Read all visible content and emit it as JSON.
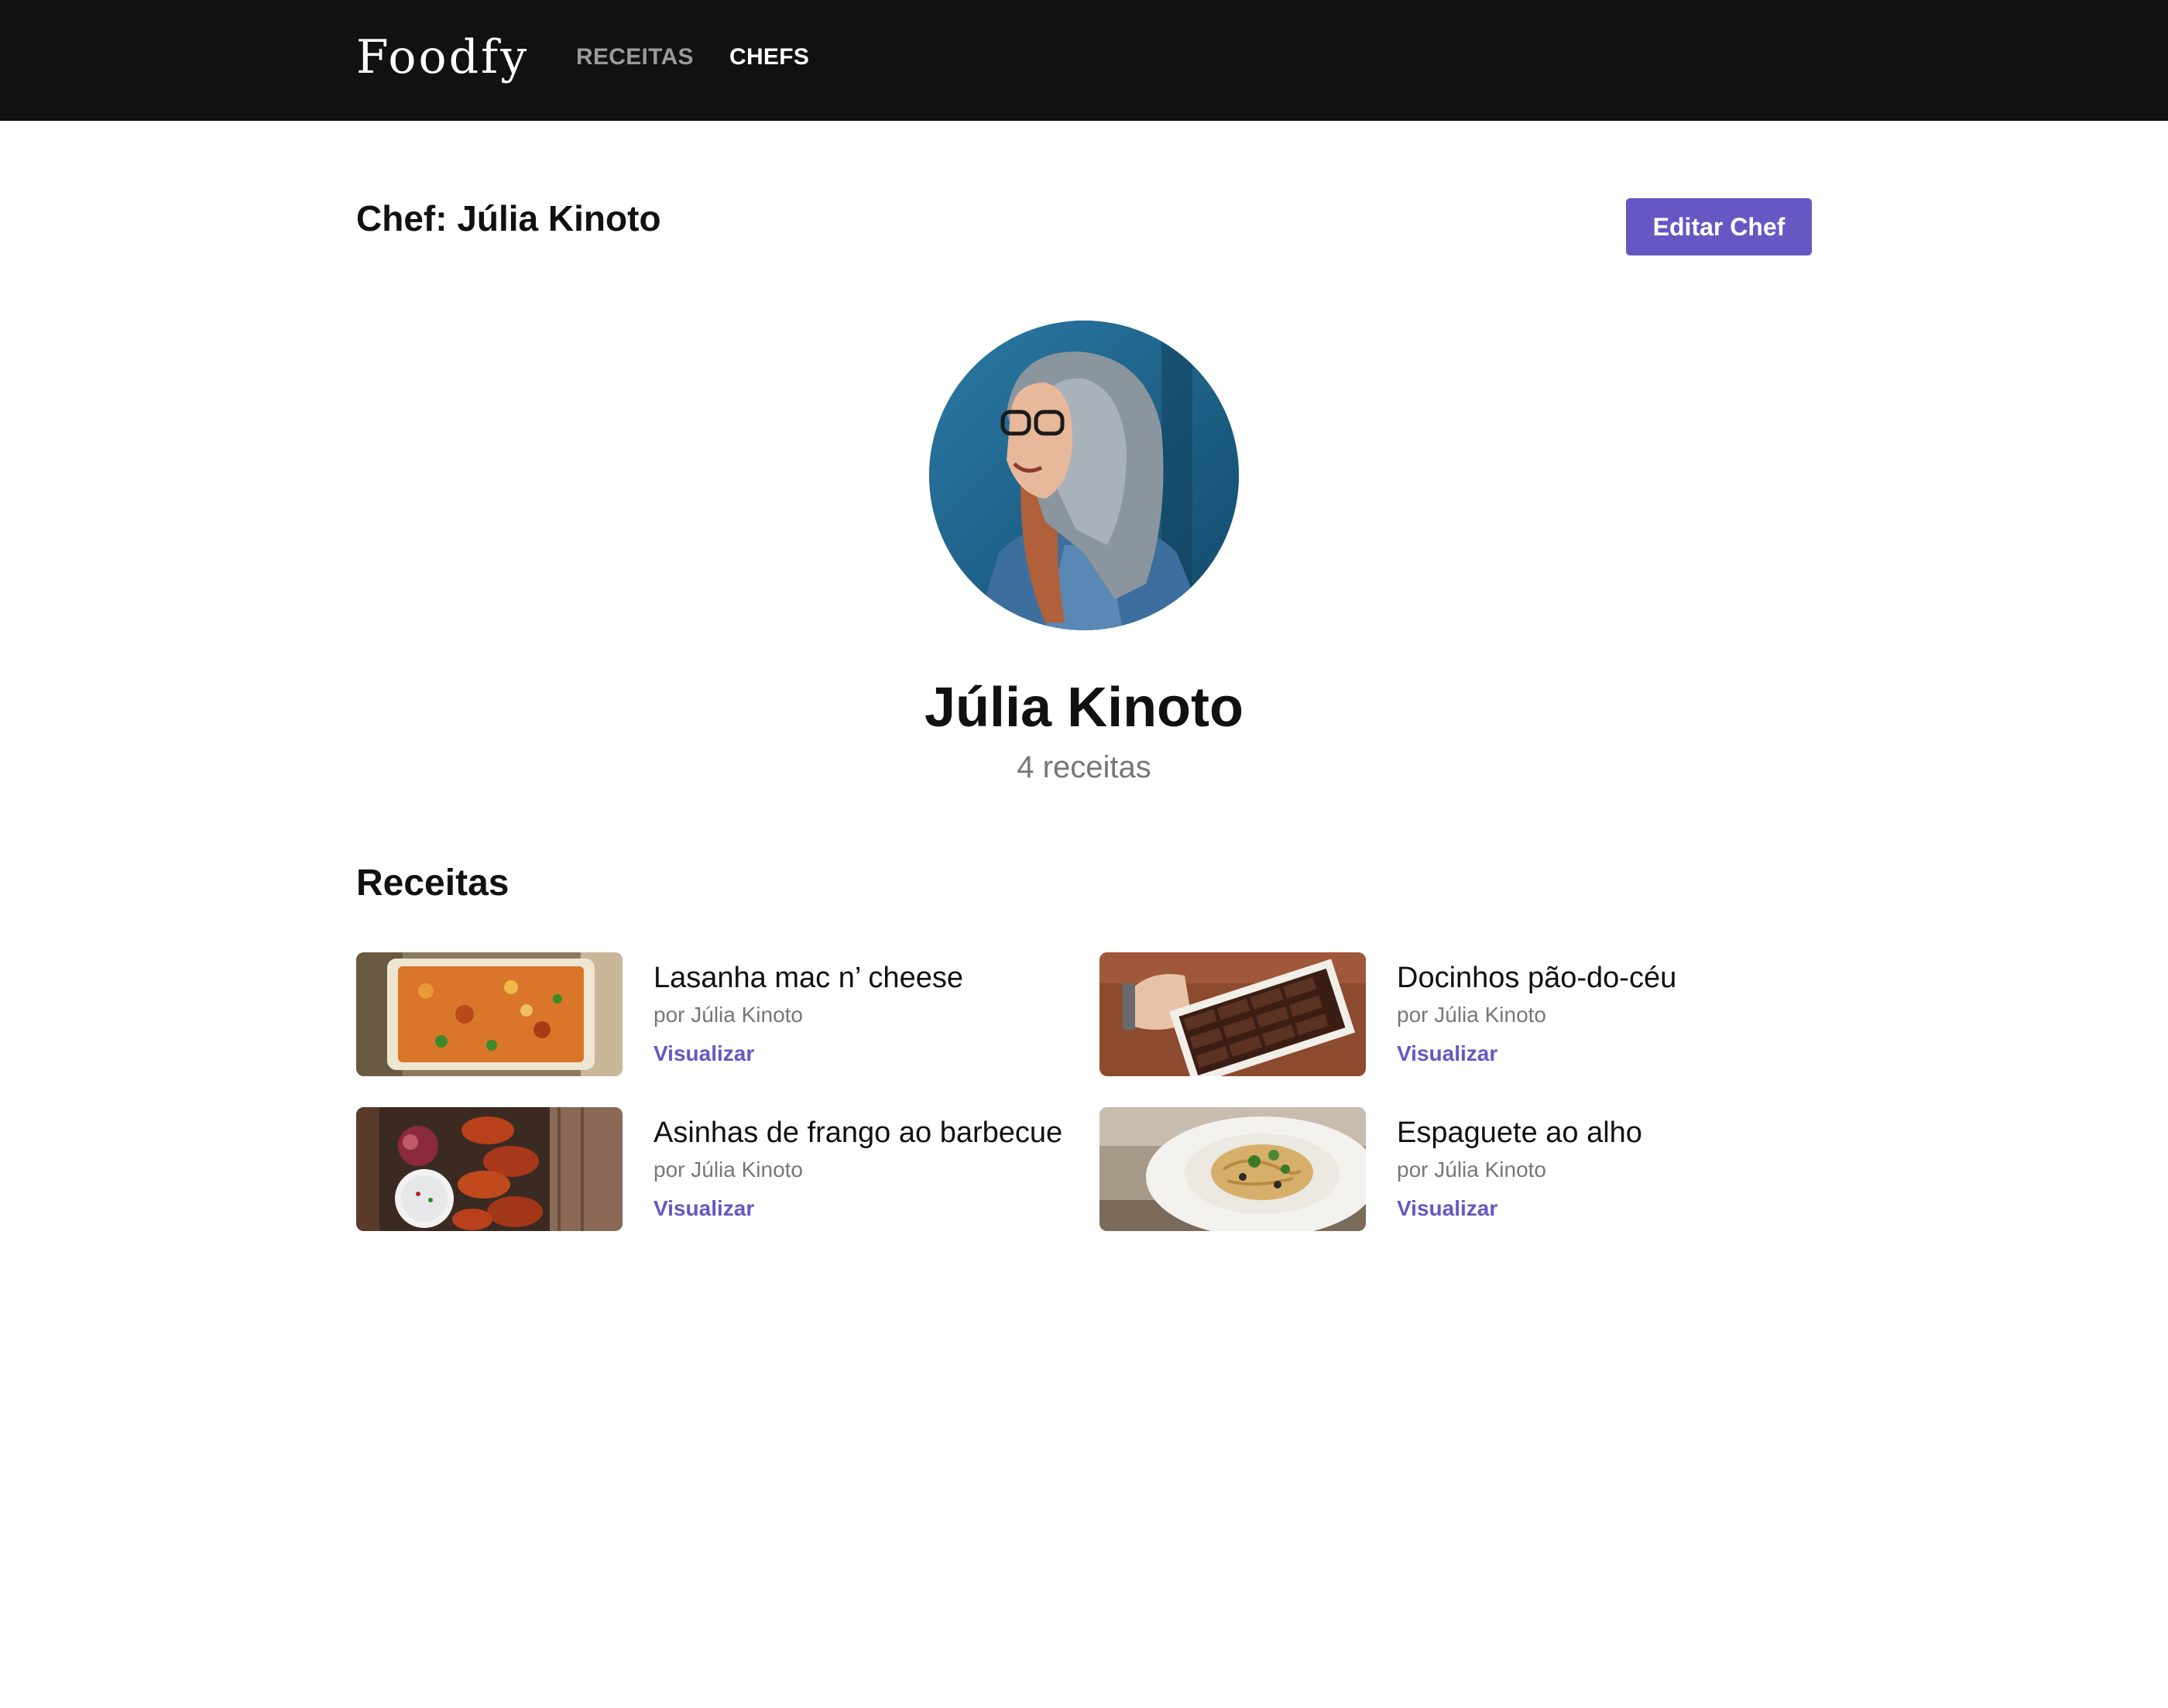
{
  "header": {
    "logo": "Foodfy",
    "nav": [
      {
        "label": "RECEITAS",
        "active": false
      },
      {
        "label": "CHEFS",
        "active": true
      }
    ]
  },
  "page": {
    "title": "Chef: Júlia Kinoto",
    "edit_button_label": "Editar Chef"
  },
  "chef": {
    "name": "Júlia Kinoto",
    "recipe_count": "4 receitas"
  },
  "recipes_section": {
    "title": "Receitas",
    "items": [
      {
        "title": "Lasanha mac n’ cheese",
        "author": "por Júlia Kinoto",
        "link": "Visualizar"
      },
      {
        "title": "Docinhos pão-do-céu",
        "author": "por Júlia Kinoto",
        "link": "Visualizar"
      },
      {
        "title": "Asinhas de frango ao barbecue",
        "author": "por Júlia Kinoto",
        "link": "Visualizar"
      },
      {
        "title": "Espaguete ao alho",
        "author": "por Júlia Kinoto",
        "link": "Visualizar"
      }
    ]
  },
  "colors": {
    "header_bg": "#111111",
    "accent": "#6558c3",
    "muted_text": "#777777"
  }
}
